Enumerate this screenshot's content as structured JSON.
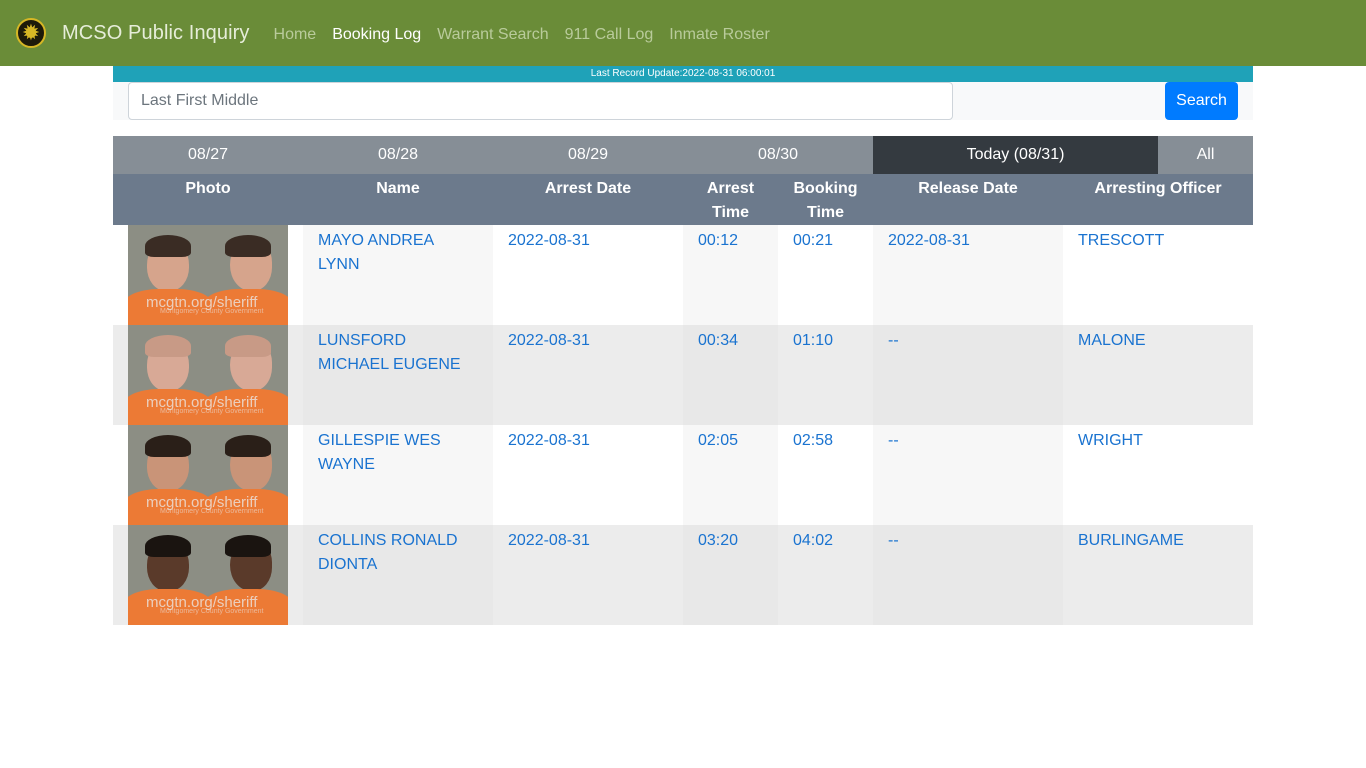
{
  "navbar": {
    "brand": "MCSO Public Inquiry",
    "logo_icon": "sheriff-badge-icon",
    "links": [
      {
        "label": "Home",
        "active": false
      },
      {
        "label": "Booking Log",
        "active": true
      },
      {
        "label": "Warrant Search",
        "active": false
      },
      {
        "label": "911 Call Log",
        "active": false
      },
      {
        "label": "Inmate Roster",
        "active": false
      }
    ]
  },
  "update_bar": {
    "text": "Last Record Update:2022-08-31 06:00:01"
  },
  "search": {
    "placeholder": "Last First Middle",
    "value": "",
    "button_label": "Search"
  },
  "date_tabs": [
    {
      "label": "08/27",
      "active": false
    },
    {
      "label": "08/28",
      "active": false
    },
    {
      "label": "08/29",
      "active": false
    },
    {
      "label": "08/30",
      "active": false
    },
    {
      "label": "Today (08/31)",
      "active": true
    },
    {
      "label": "All",
      "active": false
    }
  ],
  "table": {
    "headers": [
      "Photo",
      "Name",
      "Arrest Date",
      "Arrest Time",
      "Booking Time",
      "Release Date",
      "Arresting Officer"
    ],
    "rows": [
      {
        "name": "MAYO ANDREA LYNN",
        "arrest_date": "2022-08-31",
        "arrest_time": "00:12",
        "booking_time": "00:21",
        "release_date": "2022-08-31",
        "officer": "TRESCOTT",
        "photo_watermark": "mcgtn.org/sheriff",
        "photo_caption": "Montgomery County Government"
      },
      {
        "name": "LUNSFORD MICHAEL EUGENE",
        "arrest_date": "2022-08-31",
        "arrest_time": "00:34",
        "booking_time": "01:10",
        "release_date": "--",
        "officer": "MALONE",
        "photo_watermark": "mcgtn.org/sheriff",
        "photo_caption": "Montgomery County Government"
      },
      {
        "name": "GILLESPIE WES WAYNE",
        "arrest_date": "2022-08-31",
        "arrest_time": "02:05",
        "booking_time": "02:58",
        "release_date": "--",
        "officer": "WRIGHT",
        "photo_watermark": "mcgtn.org/sheriff",
        "photo_caption": "Montgomery County Government"
      },
      {
        "name": "COLLINS RONALD DIONTA",
        "arrest_date": "2022-08-31",
        "arrest_time": "03:20",
        "booking_time": "04:02",
        "release_date": "--",
        "officer": "BURLINGAME",
        "photo_watermark": "mcgtn.org/sheriff",
        "photo_caption": "Montgomery County Government"
      }
    ]
  },
  "colors": {
    "navbar_bg": "#6a8c38",
    "update_bar_bg": "#1fa2b8",
    "search_button": "#007bff",
    "active_tab": "#343a40",
    "tab_bg": "#868e96",
    "header_bg": "#6c7a8c",
    "link": "#1a73d0"
  }
}
